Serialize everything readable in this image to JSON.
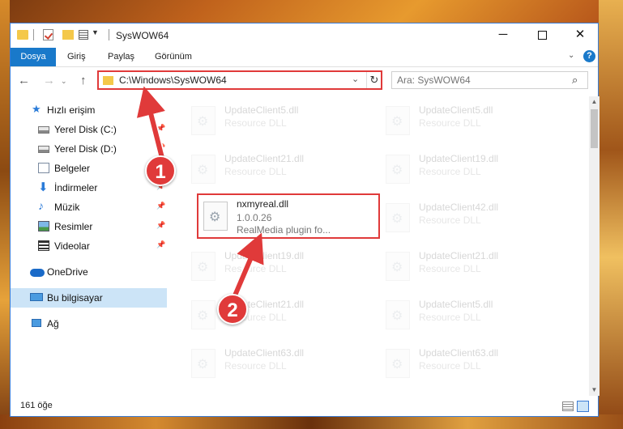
{
  "window": {
    "title": "SysWOW64",
    "controls": {
      "minimize": "─",
      "close": "✕"
    }
  },
  "ribbon": {
    "tabs": [
      {
        "label": "Dosya"
      },
      {
        "label": "Giriş"
      },
      {
        "label": "Paylaş"
      },
      {
        "label": "Görünüm"
      }
    ],
    "help": "?"
  },
  "address": {
    "path": "C:\\Windows\\SysWOW64"
  },
  "search": {
    "placeholder": "Ara: SysWOW64"
  },
  "sidebar": {
    "items": [
      {
        "label": "Hızlı erişim",
        "icon": "star-icon"
      },
      {
        "label": "Yerel Disk (C:)",
        "icon": "drive-icon",
        "pinned": true
      },
      {
        "label": "Yerel Disk (D:)",
        "icon": "drive-icon",
        "pinned": true
      },
      {
        "label": "Belgeler",
        "icon": "documents-icon",
        "pinned": true
      },
      {
        "label": "İndirmeler",
        "icon": "downloads-icon",
        "pinned": true
      },
      {
        "label": "Müzik",
        "icon": "music-icon",
        "pinned": true
      },
      {
        "label": "Resimler",
        "icon": "pictures-icon",
        "pinned": true
      },
      {
        "label": "Videolar",
        "icon": "videos-icon",
        "pinned": true
      },
      {
        "label": "OneDrive",
        "icon": "onedrive-icon"
      },
      {
        "label": "Bu bilgisayar",
        "icon": "this-pc-icon",
        "selected": true
      },
      {
        "label": "Ağ",
        "icon": "network-icon"
      }
    ]
  },
  "files": [
    {
      "name": "UpdateClient5.dll",
      "type": "Resource DLL"
    },
    {
      "name": "UpdateClient5.dll",
      "type": "Resource DLL"
    },
    {
      "name": "UpdateClient21.dll",
      "type": "Resource DLL"
    },
    {
      "name": "UpdateClient19.dll",
      "type": "Resource DLL"
    },
    {
      "name": "nxmyreal.dll",
      "version": "1.0.0.26",
      "description": "RealMedia plugin fo..."
    },
    {
      "name": "UpdateClient42.dll",
      "type": "Resource DLL"
    },
    {
      "name": "UpdateClient19.dll",
      "type": "Resource DLL"
    },
    {
      "name": "UpdateClient21.dll",
      "type": "Resource DLL"
    },
    {
      "name": "UpdateClient21.dll",
      "type": "Resource DLL"
    },
    {
      "name": "UpdateClient5.dll",
      "type": "Resource DLL"
    },
    {
      "name": "UpdateClient63.dll",
      "type": "Resource DLL"
    },
    {
      "name": "UpdateClient63.dll",
      "type": "Resource DLL"
    }
  ],
  "status": {
    "item_count": "161 öğe"
  },
  "annotations": {
    "marker1": "1",
    "marker2": "2",
    "color": "#e03a3a"
  }
}
